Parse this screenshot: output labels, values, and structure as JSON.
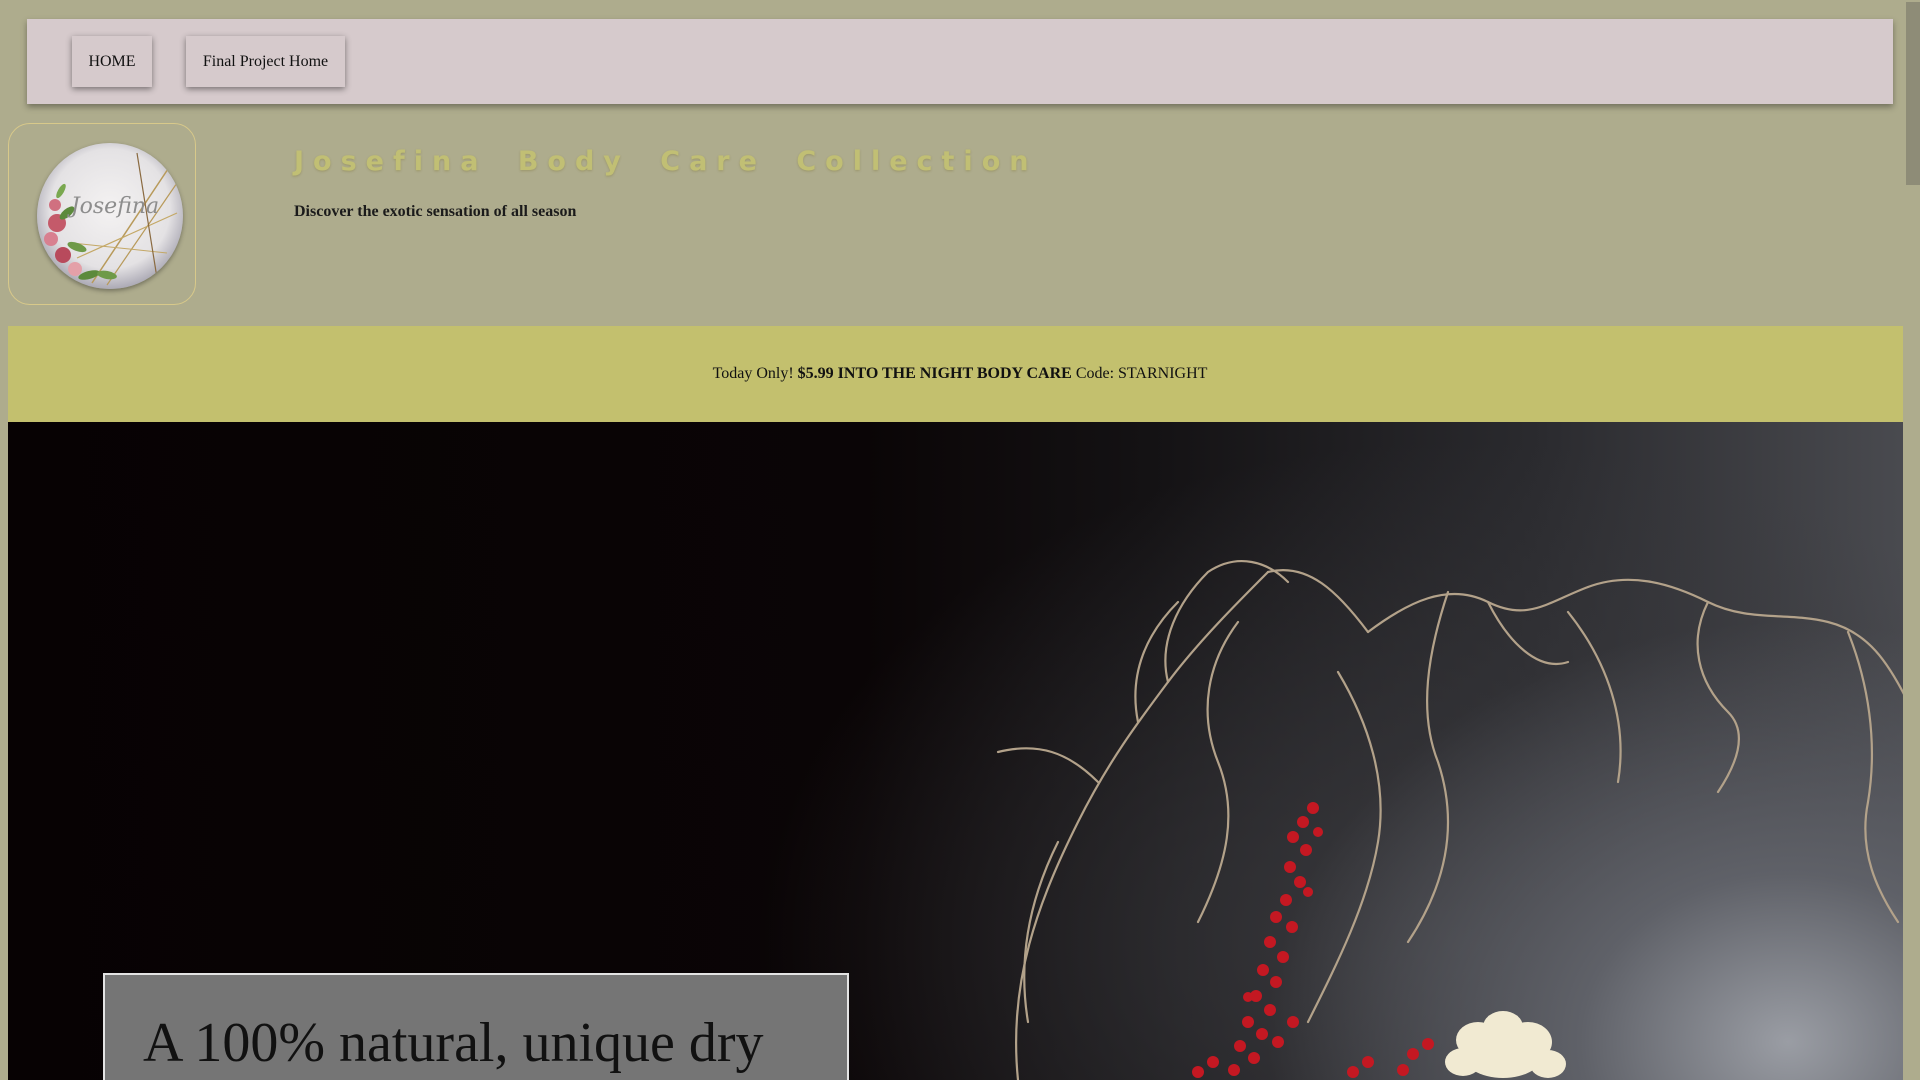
{
  "nav": {
    "home_label": "HOME",
    "final_label": "Final Project Home"
  },
  "header": {
    "logo_text": "Josefina",
    "title": "Josefina Body Care Collection",
    "tagline": "Discover the exotic sensation of all season"
  },
  "promo": {
    "prefix": "Today Only!",
    "highlight": "$5.99 INTO THE NIGHT BODY CARE",
    "code_label": "Code: STARNIGHT"
  },
  "hero": {
    "card_text": "A 100% natural, unique dry"
  },
  "colors": {
    "background": "#aeac8d",
    "navbar": "#d6cacc",
    "promo": "#c3c06e",
    "title": "#c1bf74",
    "card": "#757575"
  }
}
